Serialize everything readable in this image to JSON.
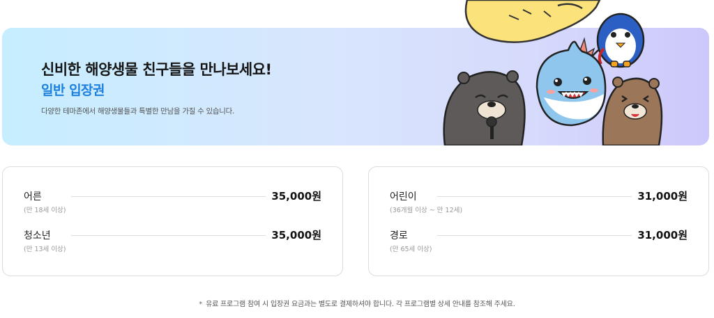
{
  "banner": {
    "headline": "신비한 해양생물 친구들을 만나보세요!",
    "subtitle": "일반 입장권",
    "description": "다양한 테마존에서 해양생물들과 특별한 만남을 가질 수 있습니다.",
    "illustration_icon": "sea-animal-mascots-icon"
  },
  "prices": {
    "left": [
      {
        "label": "어른",
        "note": "(만 18세 이상)",
        "price": "35,000원"
      },
      {
        "label": "청소년",
        "note": "(만 13세 이상)",
        "price": "35,000원"
      }
    ],
    "right": [
      {
        "label": "어린이",
        "note": "(36개월 이상 ~ 만 12세)",
        "price": "31,000원"
      },
      {
        "label": "경로",
        "note": "(만 65세 이상)",
        "price": "31,000원"
      }
    ]
  },
  "footnote": {
    "mark": "*",
    "text": "유료 프로그램 참여 시 입장권 요금과는 별도로 결제하셔야 합니다. 각 프로그램별 상세 안내를 참조해 주세요."
  },
  "colors": {
    "accent": "#1b7fe0",
    "banner_start": "#c6eefe",
    "banner_end": "#cdc8fb"
  }
}
